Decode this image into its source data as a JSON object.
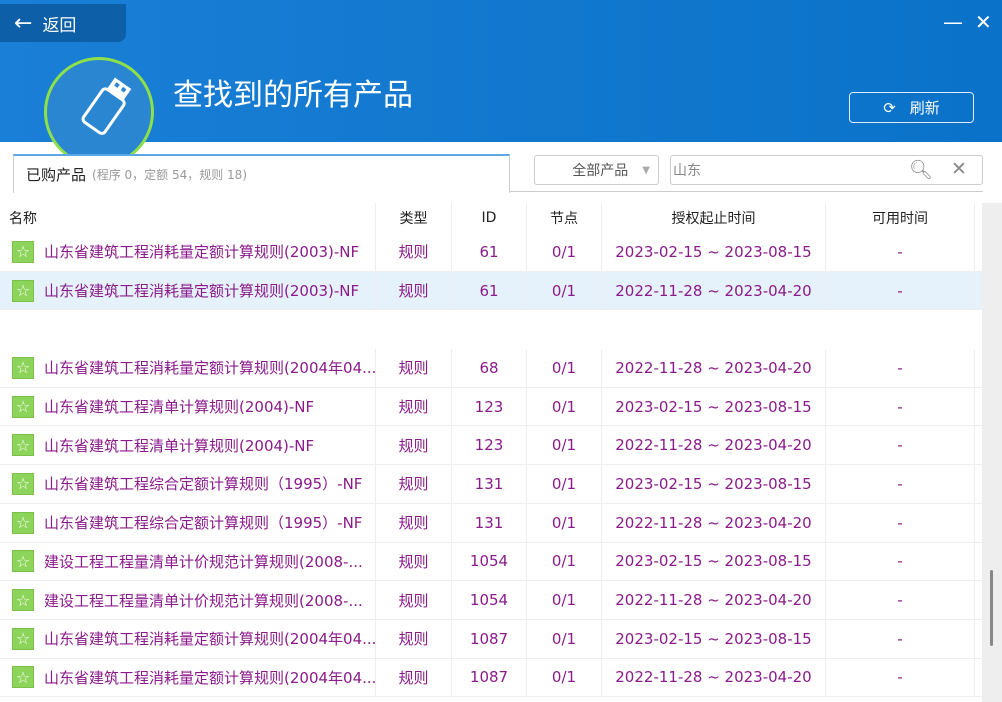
{
  "header": {
    "back_label": "返回",
    "title": "查找到的所有产品",
    "refresh_label": "刷新",
    "minimize": "—",
    "close": "✕"
  },
  "tab": {
    "label": "已购产品",
    "counts": "(程序 0，定额 54，规则 18)"
  },
  "filter": {
    "selected": "全部产品"
  },
  "search": {
    "value": "山东"
  },
  "columns": [
    "名称",
    "类型",
    "ID",
    "节点",
    "授权起止时间",
    "可用时间"
  ],
  "rows": [
    {
      "name": "山东省建筑工程消耗量定额计算规则(2003)-NF",
      "type": "规则",
      "id": "61",
      "node": "0/1",
      "period": "2023-02-15 ~ 2023-08-15",
      "avail": "-"
    },
    {
      "name": "山东省建筑工程消耗量定额计算规则(2003)-NF",
      "type": "规则",
      "id": "61",
      "node": "0/1",
      "period": "2022-11-28 ~ 2023-04-20",
      "avail": "-"
    },
    {
      "name": "山东省建筑工程消耗量定额计算规则(2004年04...",
      "type": "规则",
      "id": "68",
      "node": "0/1",
      "period": "2022-11-28 ~ 2023-04-20",
      "avail": "-"
    },
    {
      "name": "山东省建筑工程清单计算规则(2004)-NF",
      "type": "规则",
      "id": "123",
      "node": "0/1",
      "period": "2023-02-15 ~ 2023-08-15",
      "avail": "-"
    },
    {
      "name": "山东省建筑工程清单计算规则(2004)-NF",
      "type": "规则",
      "id": "123",
      "node": "0/1",
      "period": "2022-11-28 ~ 2023-04-20",
      "avail": "-"
    },
    {
      "name": "山东省建筑工程综合定额计算规则（1995）-NF",
      "type": "规则",
      "id": "131",
      "node": "0/1",
      "period": "2023-02-15 ~ 2023-08-15",
      "avail": "-"
    },
    {
      "name": "山东省建筑工程综合定额计算规则（1995）-NF",
      "type": "规则",
      "id": "131",
      "node": "0/1",
      "period": "2022-11-28 ~ 2023-04-20",
      "avail": "-"
    },
    {
      "name": "建设工程工程量清单计价规范计算规则(2008-...",
      "type": "规则",
      "id": "1054",
      "node": "0/1",
      "period": "2023-02-15 ~ 2023-08-15",
      "avail": "-"
    },
    {
      "name": "建设工程工程量清单计价规范计算规则(2008-...",
      "type": "规则",
      "id": "1054",
      "node": "0/1",
      "period": "2022-11-28 ~ 2023-04-20",
      "avail": "-"
    },
    {
      "name": "山东省建筑工程消耗量定额计算规则(2004年04...",
      "type": "规则",
      "id": "1087",
      "node": "0/1",
      "period": "2023-02-15 ~ 2023-08-15",
      "avail": "-"
    },
    {
      "name": "山东省建筑工程消耗量定额计算规则(2004年04...",
      "type": "规则",
      "id": "1087",
      "node": "0/1",
      "period": "2022-11-28 ~ 2023-04-20",
      "avail": "-"
    }
  ]
}
